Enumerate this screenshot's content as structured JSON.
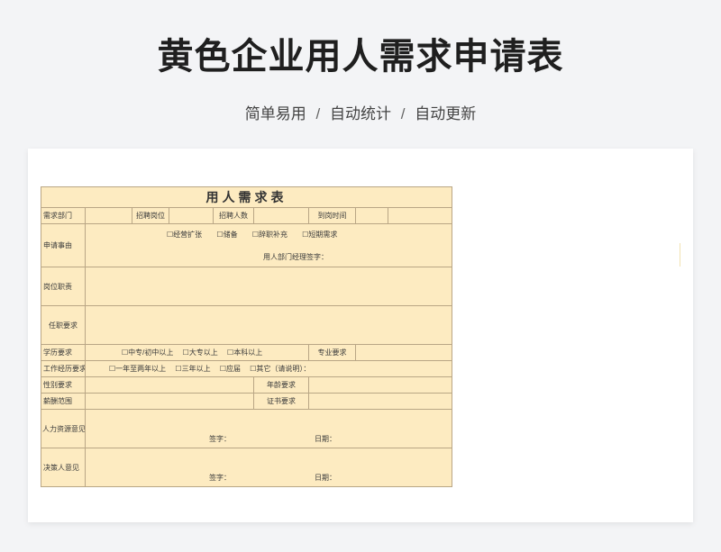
{
  "page": {
    "title": "黄色企业用人需求申请表",
    "subtitle_parts": [
      "简单易用",
      "自动统计",
      "自动更新"
    ],
    "separator": "/"
  },
  "form": {
    "heading": "用人需求表",
    "row1": {
      "dept_label": "需求部门",
      "position_label": "招聘岗位",
      "count_label": "招聘人数",
      "arrival_label": "到岗时间"
    },
    "reason": {
      "label": "申请事由",
      "options": [
        "☐经营扩张",
        "☐储备",
        "☐辞职补充",
        "☐短期需求"
      ],
      "signature": "用人部门经理签字："
    },
    "duty_label": "岗位职责",
    "qualification_label": "任职要求",
    "education": {
      "label": "学历要求",
      "options": [
        "☐中专/初中以上",
        "☐大专以上",
        "☐本科以上"
      ],
      "major_label": "专业要求"
    },
    "experience": {
      "label": "工作经历要求",
      "options": [
        "☐一年至两年以上",
        "☐三年以上",
        "☐应届",
        "☐其它（请说明）："
      ]
    },
    "gender_label": "性别要求",
    "age_label": "年龄要求",
    "salary_label": "薪酬范围",
    "cert_label": "证书要求",
    "hr_opinion": {
      "label": "人力资源意见",
      "sign": "签字：",
      "date": "日期："
    },
    "decision_opinion": {
      "label": "决策人意见",
      "sign": "签字：",
      "date": "日期："
    }
  },
  "colors": {
    "background": "#f3f4f6",
    "header_fill": "#ecd9ae",
    "cell_fill": "#fdebc1",
    "border": "#b9a685"
  }
}
